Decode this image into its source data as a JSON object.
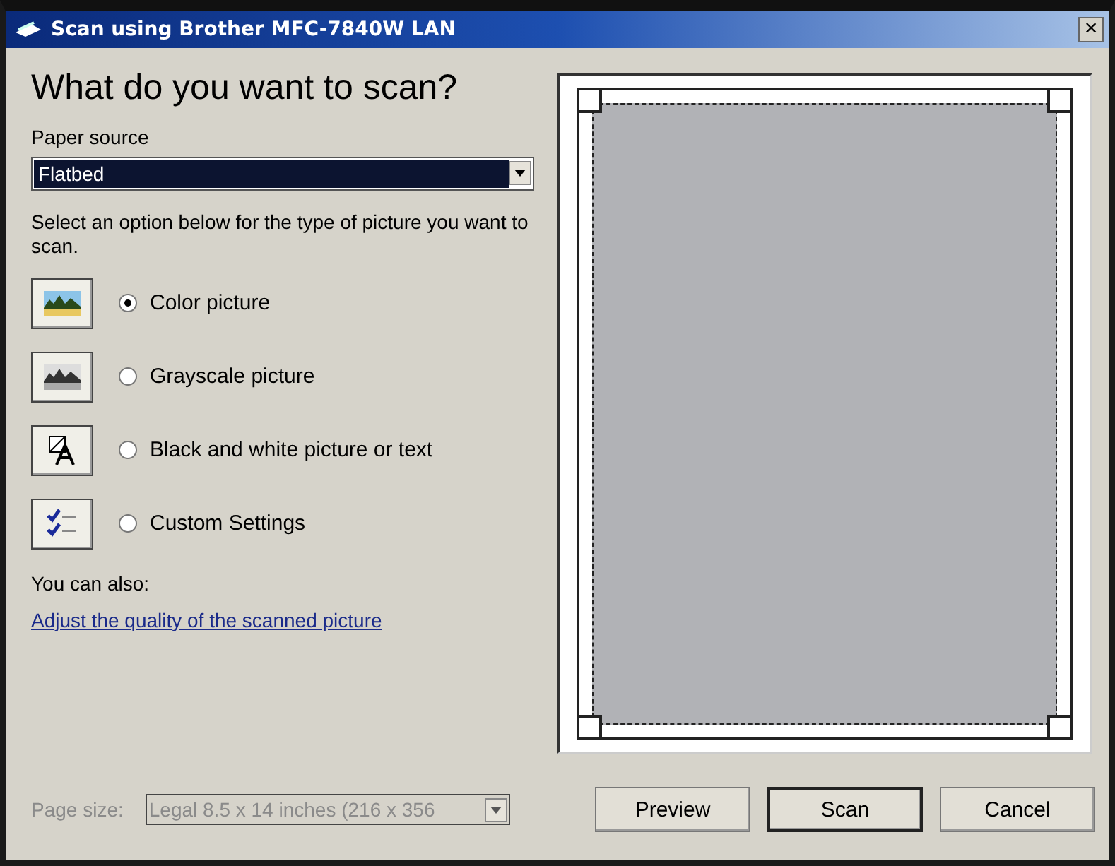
{
  "window": {
    "title": "Scan using Brother MFC-7840W LAN",
    "close": "×"
  },
  "heading": "What do you want to scan?",
  "paper_source": {
    "label": "Paper source",
    "value": "Flatbed",
    "focused": true
  },
  "instruction": "Select an option below for the type of picture you want to scan.",
  "options": [
    {
      "kind": "color",
      "label": "Color picture",
      "selected": true
    },
    {
      "kind": "grayscale",
      "label": "Grayscale picture",
      "selected": false
    },
    {
      "kind": "bw",
      "label": "Black and white picture or text",
      "selected": false
    },
    {
      "kind": "custom",
      "label": "Custom Settings",
      "selected": false
    }
  ],
  "also_label": "You can also:",
  "link": "Adjust the quality of the scanned picture",
  "page_size": {
    "label": "Page size:",
    "value": "Legal 8.5 x 14 inches (216 x 356",
    "disabled": true
  },
  "buttons": [
    {
      "label": "Preview",
      "default": false
    },
    {
      "label": "Scan",
      "default": true
    },
    {
      "label": "Cancel",
      "default": false
    }
  ]
}
